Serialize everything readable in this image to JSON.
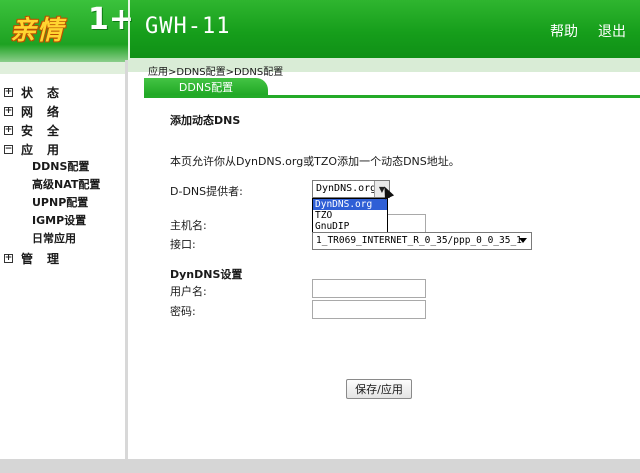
{
  "header": {
    "logo_text": "亲情",
    "logo_plus": "1+",
    "model": "GWH-11",
    "help_label": "帮助",
    "exit_label": "退出"
  },
  "sidebar": {
    "items": [
      {
        "box": "+",
        "label": "状态"
      },
      {
        "box": "+",
        "label": "网络"
      },
      {
        "box": "+",
        "label": "安全"
      },
      {
        "box": "−",
        "label": "应用"
      },
      {
        "box": "+",
        "label": "管理"
      }
    ],
    "subitems": [
      "DDNS配置",
      "高级NAT配置",
      "UPNP配置",
      "IGMP设置",
      "日常应用"
    ]
  },
  "content": {
    "breadcrumb": "应用>DDNS配置>DDNS配置",
    "tab_label": "DDNS配置",
    "section_title": "添加动态DNS",
    "description": "本页允许你从DynDNS.org或TZO添加一个动态DNS地址。",
    "provider_label": "D-DNS提供者:",
    "provider_selected": "DynDNS.org",
    "provider_options": [
      "DynDNS.org",
      "TZO",
      "GnuDIP"
    ],
    "hostname_label": "主机名:",
    "interface_label": "接口:",
    "interface_selected": "1_TR069_INTERNET_R_0_35/ppp_0_0_35_1",
    "dyndns_section": "DynDNS设置",
    "username_label": "用户名:",
    "password_label": "密码:",
    "save_label": "保存/应用"
  }
}
